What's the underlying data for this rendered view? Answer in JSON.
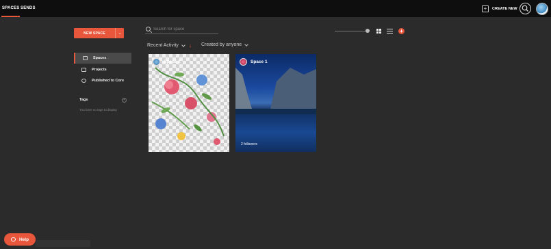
{
  "nav": {
    "tabs": [
      {
        "label": "SPACES"
      },
      {
        "label": "SENDS"
      }
    ],
    "create_new_label": "CREATE NEW"
  },
  "sidebar": {
    "new_space_label": "NEW SPACE",
    "items": [
      {
        "label": "Spaces"
      },
      {
        "label": "Projects"
      },
      {
        "label": "Published to Core"
      }
    ],
    "tags_title": "Tags",
    "tags_empty": "You have no tags to display"
  },
  "toolbar": {
    "search_placeholder": "Search for space"
  },
  "filters": {
    "sort_label": "Recent Activity",
    "owner_label": "Created by anyone"
  },
  "cards": [
    {
      "title": "Space 2",
      "followers": ""
    },
    {
      "title": "Space 1",
      "followers": "2 followers"
    }
  ],
  "help_label": "Help",
  "colors": {
    "accent": "#e8573b",
    "background": "#2b2b2b",
    "topbar": "#0e0e0e"
  }
}
